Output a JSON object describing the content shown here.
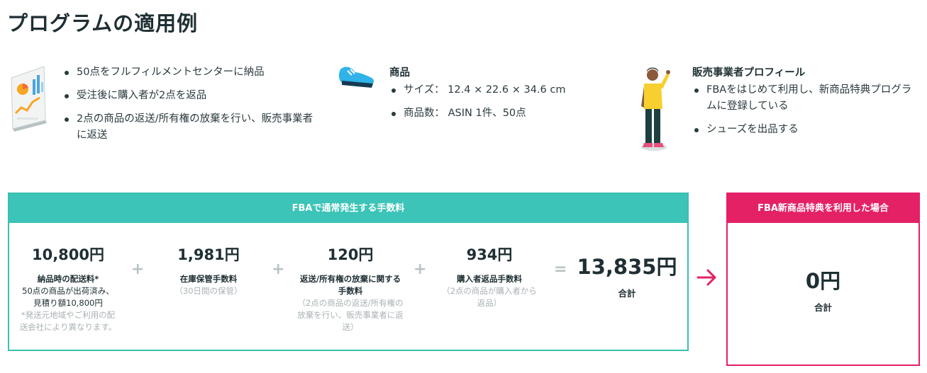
{
  "page": {
    "title": "プログラムの適用例"
  },
  "shipment": {
    "bullets": [
      "50点をフルフィルメントセンターに納品",
      "受注後に購入者が2点を返品",
      "2点の商品の返送/所有権の放棄を行い、販売事業者に返送"
    ]
  },
  "product": {
    "title": "商品",
    "bullets": [
      "サイズ： 12.4 × 22.6 × 34.6 cm",
      "商品数： ASIN 1件、50点"
    ]
  },
  "seller": {
    "title": "販売事業者プロフィール",
    "bullets": [
      "FBAをはじめて利用し、新商品特典プログラムに登録している",
      "シューズを出品する"
    ]
  },
  "fees": {
    "header": "FBAで通常発生する手数料",
    "items": [
      {
        "amount": "10,800円",
        "label": "納品時の配送料*",
        "sub": "50点の商品が出荷済み、見積り額10,800円",
        "note": "*発送元地域やご利用の配送会社により異なります。"
      },
      {
        "amount": "1,981円",
        "label": "在庫保管手数料",
        "note": "（30日間の保管）"
      },
      {
        "amount": "120円",
        "label": "返送/所有権の放棄に関する手数料",
        "note": "（2点の商品の返送/所有権の放棄を行い、販売事業者に返送）"
      },
      {
        "amount": "934円",
        "label": "購入者返品手数料",
        "note": "（2点の商品が購入者から返品）"
      }
    ],
    "operators": [
      "+",
      "+",
      "+",
      "="
    ],
    "total": {
      "amount": "13,835円",
      "label": "合計"
    }
  },
  "promo": {
    "header": "FBA新商品特典を利用した場合",
    "total": {
      "amount": "0円",
      "label": "合計"
    }
  },
  "icons": {
    "chart": "chart-board-icon",
    "shoe": "shoe-icon",
    "seller": "seller-person-icon",
    "arrow": "arrow-right-icon"
  },
  "colors": {
    "teal": "#3bc4b7",
    "pink": "#e52166",
    "text": "#1f2f33"
  }
}
